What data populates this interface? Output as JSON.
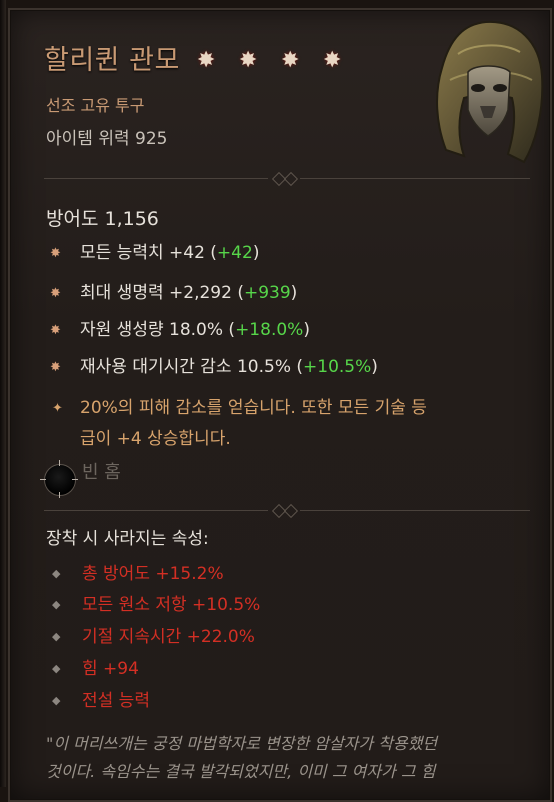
{
  "item": {
    "name": "할리퀸 관모",
    "stars": [
      "✸",
      "✸",
      "✸",
      "✸"
    ],
    "type": "선조 고유 투구",
    "item_power": "아이템 위력 925",
    "icon": "helm-icon"
  },
  "armor": "방어도 1,156",
  "stats": [
    {
      "text": "모든 능력치 +42 (",
      "bonus": "+42",
      "close": ")"
    },
    {
      "text": "최대 생명력 +2,292 (",
      "bonus": "+939",
      "close": ")"
    },
    {
      "text": "자원 생성량 18.0% (",
      "bonus": "+18.0%",
      "close": ")"
    },
    {
      "text": "재사용 대기시간 감소 10.5% (",
      "bonus": "+10.5%",
      "close": ")"
    }
  ],
  "legendary": {
    "line1": "20%의 피해 감소를 얻습니다. 또한 모든 기술 등",
    "line2": "급이 +4 상승합니다."
  },
  "socket": {
    "label": "빈 홈"
  },
  "lost_header": "장착 시 사라지는 속성:",
  "lost": [
    "총 방어도 +15.2%",
    "모든 원소 저항 +10.5%",
    "기절 지속시간 +22.0%",
    "힘 +94",
    "전설 능력"
  ],
  "flavor": {
    "line1": "\"이 머리쓰개는 궁정 마법학자로 변장한 암살자가 착용했던",
    "line2": "것이다. 속임수는 결국 발각되었지만, 이미 그 여자가 그 힘"
  },
  "colors": {
    "title": "#c99a74",
    "bonus": "#57d64a",
    "legendary": "#d7a36c",
    "lost": "#d32f24"
  }
}
